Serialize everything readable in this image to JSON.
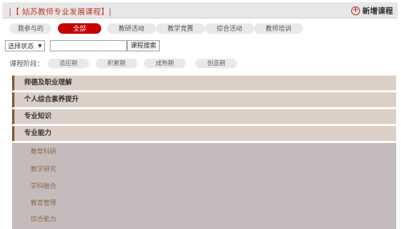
{
  "header": {
    "title": "|【 姑苏教师专业发展课程】|",
    "add_label": "新增课程",
    "accent": "#c40000"
  },
  "tabs": [
    {
      "label": "我参与的",
      "active": false
    },
    {
      "label": "全部",
      "active": true
    },
    {
      "label": "教研活动",
      "active": false
    },
    {
      "label": "教学竞赛",
      "active": false
    },
    {
      "label": "综合活动",
      "active": false
    },
    {
      "label": "教师培训",
      "active": false
    }
  ],
  "filter": {
    "status_select": "选择状态",
    "search_value": "",
    "search_button": "课程搜索"
  },
  "stage": {
    "label": "课程阶段：",
    "options": [
      "适应期",
      "积累期",
      "成熟期",
      "创造期"
    ]
  },
  "categories": [
    "师德及职业理解",
    "个人综合素养提升",
    "专业知识",
    "专业能力"
  ],
  "sub_items": [
    "教育科研",
    "教学研究",
    "学科融合",
    "教育管理",
    "综合能力"
  ]
}
